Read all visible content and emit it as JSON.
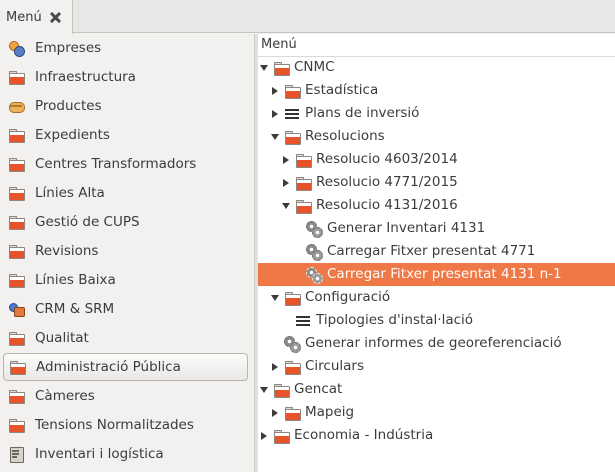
{
  "tab": {
    "label": "Menú"
  },
  "sidebar": {
    "items": [
      {
        "label": "Empreses",
        "icon": "people-icon"
      },
      {
        "label": "Infraestructura",
        "icon": "folder-icon"
      },
      {
        "label": "Productes",
        "icon": "box-icon"
      },
      {
        "label": "Expedients",
        "icon": "folder-icon"
      },
      {
        "label": "Centres Transformadors",
        "icon": "folder-icon"
      },
      {
        "label": "Línies Alta",
        "icon": "folder-icon"
      },
      {
        "label": "Gestió de CUPS",
        "icon": "folder-icon"
      },
      {
        "label": "Revisions",
        "icon": "folder-icon"
      },
      {
        "label": "Línies Baixa",
        "icon": "folder-icon"
      },
      {
        "label": "CRM & SRM",
        "icon": "crm-icon"
      },
      {
        "label": "Qualitat",
        "icon": "folder-icon"
      },
      {
        "label": "Administració Pública",
        "icon": "folder-icon",
        "active": true
      },
      {
        "label": "Càmeres",
        "icon": "folder-icon"
      },
      {
        "label": "Tensions Normalitzades",
        "icon": "folder-icon"
      },
      {
        "label": "Inventari i logística",
        "icon": "inventory-icon"
      }
    ]
  },
  "tree": {
    "header": "Menú",
    "nodes": [
      {
        "label": "CNMC",
        "level": 0,
        "expander": "expanded",
        "icon": "folder-icon"
      },
      {
        "label": "Estadística",
        "level": 1,
        "expander": "collapsed",
        "icon": "folder-icon"
      },
      {
        "label": "Plans de inversió",
        "level": 1,
        "expander": "collapsed",
        "icon": "list-icon"
      },
      {
        "label": "Resolucions",
        "level": 1,
        "expander": "expanded",
        "icon": "folder-icon"
      },
      {
        "label": "Resolucio 4603/2014",
        "level": 2,
        "expander": "collapsed",
        "icon": "folder-icon"
      },
      {
        "label": "Resolucio 4771/2015",
        "level": 2,
        "expander": "collapsed",
        "icon": "folder-icon"
      },
      {
        "label": "Resolucio 4131/2016",
        "level": 2,
        "expander": "expanded",
        "icon": "folder-icon"
      },
      {
        "label": "Generar Inventari 4131",
        "level": 3,
        "expander": "none",
        "icon": "gears-icon"
      },
      {
        "label": "Carregar Fitxer presentat 4771",
        "level": 3,
        "expander": "none",
        "icon": "gears-icon"
      },
      {
        "label": "Carregar Fitxer presentat 4131 n-1",
        "level": 3,
        "expander": "none",
        "icon": "gears-icon",
        "selected": true
      },
      {
        "label": "Configuració",
        "level": 1,
        "expander": "expanded",
        "icon": "folder-icon"
      },
      {
        "label": "Tipologies d'instal·lació",
        "level": 2,
        "expander": "none",
        "icon": "list-icon"
      },
      {
        "label": "Generar informes de georeferenciació",
        "level": 1,
        "expander": "none",
        "icon": "gears-icon"
      },
      {
        "label": "Circulars",
        "level": 1,
        "expander": "collapsed",
        "icon": "folder-icon"
      },
      {
        "label": "Gencat",
        "level": 0,
        "expander": "expanded",
        "icon": "folder-icon"
      },
      {
        "label": "Mapeig",
        "level": 1,
        "expander": "collapsed",
        "icon": "folder-icon"
      },
      {
        "label": "Economia - Indústria",
        "level": 0,
        "expander": "collapsed",
        "icon": "folder-icon"
      }
    ]
  },
  "colors": {
    "selection": "#f07746",
    "folder": "#e8542a"
  }
}
